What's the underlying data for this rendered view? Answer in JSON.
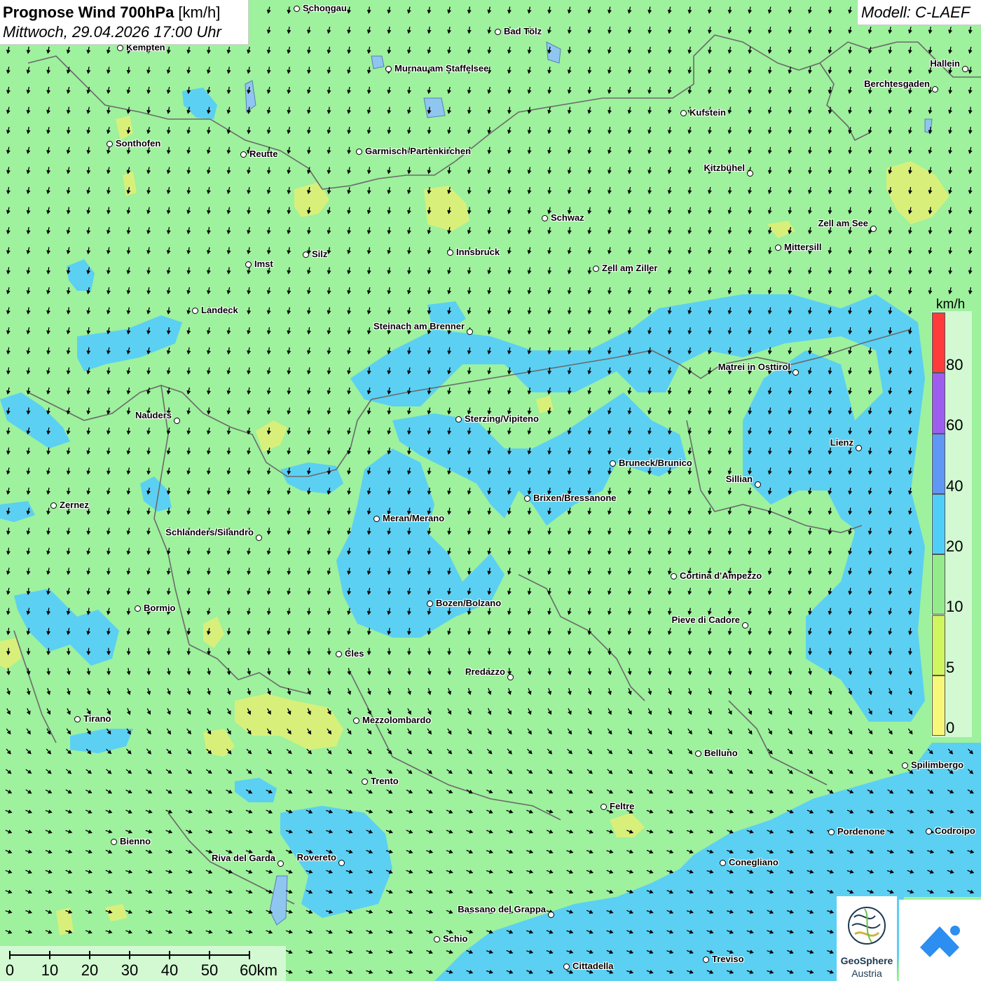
{
  "header": {
    "title_bold": "Prognose Wind 700hPa",
    "title_unit": " [km/h]",
    "datetime": "Mittwoch, 29.04.2026 17:00 Uhr"
  },
  "model": {
    "label": "Modell: C-LAEF"
  },
  "legend": {
    "unit": "km/h",
    "segments": [
      {
        "label": "80",
        "color": "#ff3b3b"
      },
      {
        "label": "60",
        "color": "#9d5ef0"
      },
      {
        "label": "40",
        "color": "#5e98f4"
      },
      {
        "label": "20",
        "color": "#4fcff7"
      },
      {
        "label": "10",
        "color": "#94eb8c"
      },
      {
        "label": "5",
        "color": "#cff55f"
      },
      {
        "label": "0",
        "color": "#f7f779"
      }
    ]
  },
  "scale_bar": {
    "labels": [
      "0",
      "10",
      "20",
      "30",
      "40",
      "50",
      "60km"
    ]
  },
  "logos": {
    "geosphere_name": "GeoSphere",
    "geosphere_sub": "Austria"
  },
  "cities": [
    {
      "name": "Schongau",
      "side": "right"
    },
    {
      "name": "Bad Tölz",
      "side": "right"
    },
    {
      "name": "Kempten",
      "side": "right"
    },
    {
      "name": "Murnau am Staffelsee",
      "side": "right"
    },
    {
      "name": "Hallein",
      "side": "left"
    },
    {
      "name": "Berchtesgaden",
      "side": "left"
    },
    {
      "name": "Kufstein",
      "side": "right"
    },
    {
      "name": "Sonthofen",
      "side": "right"
    },
    {
      "name": "Reutte",
      "side": "right"
    },
    {
      "name": "Garmisch-Partenkirchen",
      "side": "right"
    },
    {
      "name": "Kitzbühel",
      "side": "left"
    },
    {
      "name": "Schwaz",
      "side": "right"
    },
    {
      "name": "Zell am See",
      "side": "left"
    },
    {
      "name": "Mittersill",
      "side": "right"
    },
    {
      "name": "Innsbruck",
      "side": "right"
    },
    {
      "name": "Silz",
      "side": "right"
    },
    {
      "name": "Imst",
      "side": "right"
    },
    {
      "name": "Zell am Ziller",
      "side": "right"
    },
    {
      "name": "Landeck",
      "side": "right"
    },
    {
      "name": "Steinach am Brenner",
      "side": "left"
    },
    {
      "name": "Matrei in Osttirol",
      "side": "left"
    },
    {
      "name": "Nauders",
      "side": "left"
    },
    {
      "name": "Sterzing/Vipiteno",
      "side": "right"
    },
    {
      "name": "Lienz",
      "side": "left"
    },
    {
      "name": "Bruneck/Brunico",
      "side": "right"
    },
    {
      "name": "Sillian",
      "side": "left"
    },
    {
      "name": "Zernez",
      "side": "right"
    },
    {
      "name": "Brixen/Bressanone",
      "side": "right"
    },
    {
      "name": "Meran/Merano",
      "side": "right"
    },
    {
      "name": "Schlanders/Silandro",
      "side": "left"
    },
    {
      "name": "Cortina d'Ampezzo",
      "side": "right"
    },
    {
      "name": "Bozen/Bolzano",
      "side": "right"
    },
    {
      "name": "Bormio",
      "side": "right"
    },
    {
      "name": "Pieve di Cadore",
      "side": "left"
    },
    {
      "name": "Cles",
      "side": "right"
    },
    {
      "name": "Predazzo",
      "side": "left"
    },
    {
      "name": "Tirano",
      "side": "right"
    },
    {
      "name": "Mezzolombardo",
      "side": "right"
    },
    {
      "name": "Belluno",
      "side": "right"
    },
    {
      "name": "Spilimbergo",
      "side": "right"
    },
    {
      "name": "Trento",
      "side": "right"
    },
    {
      "name": "Feltre",
      "side": "right"
    },
    {
      "name": "Pordenone",
      "side": "right"
    },
    {
      "name": "Codroipo",
      "side": "right"
    },
    {
      "name": "Bienno",
      "side": "right"
    },
    {
      "name": "Riva del Garda",
      "side": "left"
    },
    {
      "name": "Rovereto",
      "side": "left"
    },
    {
      "name": "Conegliano",
      "side": "right"
    },
    {
      "name": "Bassano del Grappa",
      "side": "left"
    },
    {
      "name": "Schio",
      "side": "right"
    },
    {
      "name": "Treviso",
      "side": "right"
    },
    {
      "name": "Cittadella",
      "side": "right"
    }
  ],
  "colors": {
    "background_10_20": "#9ef19d",
    "zone_20_40": "#5bd0f3",
    "zone_5_10": "#d8f07a"
  }
}
